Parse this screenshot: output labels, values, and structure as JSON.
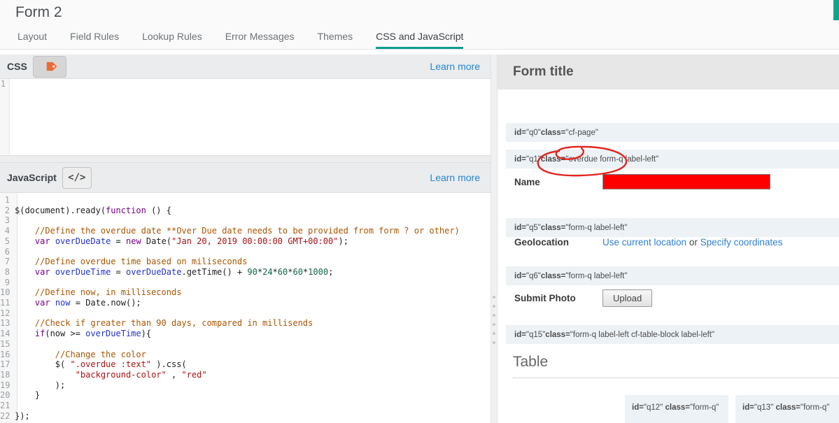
{
  "header": {
    "title": "Form 2"
  },
  "tabs": [
    {
      "label": "Layout",
      "active": false
    },
    {
      "label": "Field Rules",
      "active": false
    },
    {
      "label": "Lookup Rules",
      "active": false
    },
    {
      "label": "Error Messages",
      "active": false
    },
    {
      "label": "Themes",
      "active": false
    },
    {
      "label": "CSS and JavaScript",
      "active": true
    }
  ],
  "colors": {
    "accent_teal": "#0f9d8e",
    "link_blue": "#2487cf",
    "annotation_red": "#e0261f",
    "field_red": "#ff0000"
  },
  "css_panel": {
    "title": "CSS",
    "icon": "tag-icon",
    "learn_more": "Learn more",
    "code_lines": [
      []
    ]
  },
  "js_panel": {
    "title": "JavaScript",
    "icon": "code-icon",
    "learn_more": "Learn more",
    "code_lines": [
      [],
      [
        [
          "p",
          "$(document).ready("
        ],
        [
          "k",
          "function"
        ],
        [
          "p",
          " () {"
        ]
      ],
      [],
      [
        [
          "c",
          "    //Define the overdue date **Over Due date needs to be provided from form ? or other)"
        ]
      ],
      [
        [
          "p",
          "    "
        ],
        [
          "k",
          "var"
        ],
        [
          "p",
          " "
        ],
        [
          "d",
          "overDueDate"
        ],
        [
          "p",
          " = "
        ],
        [
          "k",
          "new"
        ],
        [
          "p",
          " Date("
        ],
        [
          "s",
          "\"Jan 20, 2019 00:00:00 GMT+00:00\""
        ],
        [
          "p",
          ");"
        ]
      ],
      [],
      [
        [
          "c",
          "    //Define overdue time based on miliseconds"
        ]
      ],
      [
        [
          "p",
          "    "
        ],
        [
          "k",
          "var"
        ],
        [
          "p",
          " "
        ],
        [
          "d",
          "overDueTime"
        ],
        [
          "p",
          " = "
        ],
        [
          "d",
          "overDueDate"
        ],
        [
          "p",
          ".getTime() + "
        ],
        [
          "n",
          "90"
        ],
        [
          "p",
          "*"
        ],
        [
          "n",
          "24"
        ],
        [
          "p",
          "*"
        ],
        [
          "n",
          "60"
        ],
        [
          "p",
          "*"
        ],
        [
          "n",
          "60"
        ],
        [
          "p",
          "*"
        ],
        [
          "n",
          "1000"
        ],
        [
          "p",
          ";"
        ]
      ],
      [],
      [
        [
          "c",
          "    //Define now, in milliseconds"
        ]
      ],
      [
        [
          "p",
          "    "
        ],
        [
          "k",
          "var"
        ],
        [
          "p",
          " "
        ],
        [
          "d",
          "now"
        ],
        [
          "p",
          " = Date.now();"
        ]
      ],
      [],
      [
        [
          "c",
          "    //Check if greater than 90 days, compared in millisends"
        ]
      ],
      [
        [
          "p",
          "    "
        ],
        [
          "k",
          "if"
        ],
        [
          "p",
          "(now >= "
        ],
        [
          "d",
          "overDueTime"
        ],
        [
          "p",
          "){"
        ]
      ],
      [],
      [
        [
          "c",
          "        //Change the color"
        ]
      ],
      [
        [
          "p",
          "        $( "
        ],
        [
          "s",
          "\".overdue :text\""
        ],
        [
          "p",
          " ).css("
        ]
      ],
      [
        [
          "p",
          "            "
        ],
        [
          "s",
          "\"background-color\""
        ],
        [
          "p",
          " , "
        ],
        [
          "s",
          "\"red\""
        ]
      ],
      [
        [
          "p",
          "        );"
        ]
      ],
      [
        [
          "p",
          "    }"
        ]
      ],
      [],
      [
        [
          "p",
          "});"
        ]
      ]
    ]
  },
  "preview": {
    "form_title": "Form title",
    "bars": {
      "q0": [
        {
          "t": "id=",
          "b": 1
        },
        {
          "t": "\"q0\" ",
          "b": 0
        },
        {
          "t": "class=",
          "b": 1
        },
        {
          "t": "\"cf-page\"",
          "b": 0
        }
      ],
      "q1": [
        {
          "t": "id=",
          "b": 1
        },
        {
          "t": "\"q1\" ",
          "b": 0
        },
        {
          "t": "class=",
          "b": 1
        },
        {
          "t": "\"overdue form-q label-left\"",
          "b": 0
        }
      ],
      "q5": [
        {
          "t": "id=",
          "b": 1
        },
        {
          "t": "\"q5\" ",
          "b": 0
        },
        {
          "t": "class=",
          "b": 1
        },
        {
          "t": "\"form-q label-left\"",
          "b": 0
        }
      ],
      "q6": [
        {
          "t": "id=",
          "b": 1
        },
        {
          "t": "\"q6\" ",
          "b": 0
        },
        {
          "t": "class=",
          "b": 1
        },
        {
          "t": "\"form-q label-left\"",
          "b": 0
        }
      ],
      "q15": [
        {
          "t": "id=",
          "b": 1
        },
        {
          "t": "\"q15\" ",
          "b": 0
        },
        {
          "t": "class=",
          "b": 1
        },
        {
          "t": "\"form-q label-left cf-table-block label-left\"",
          "b": 0
        }
      ],
      "q12": [
        {
          "t": "id=",
          "b": 1
        },
        {
          "t": "\"q12\" ",
          "b": 0
        },
        {
          "t": "class=",
          "b": 1
        },
        {
          "t": "\"form-q\"",
          "b": 0
        }
      ],
      "q13": [
        {
          "t": "id=",
          "b": 1
        },
        {
          "t": "\"q13\" ",
          "b": 0
        },
        {
          "t": "class=",
          "b": 1
        },
        {
          "t": "\"form-q\"",
          "b": 0
        }
      ]
    },
    "fields": {
      "name": {
        "label": "Name"
      },
      "geolocation": {
        "label": "Geolocation",
        "link1": "Use current location",
        "separator": " or ",
        "link2": "Specify coordinates"
      },
      "submit_photo": {
        "label": "Submit Photo",
        "button_label": "Upload"
      }
    },
    "table_section": {
      "title": "Table"
    }
  }
}
